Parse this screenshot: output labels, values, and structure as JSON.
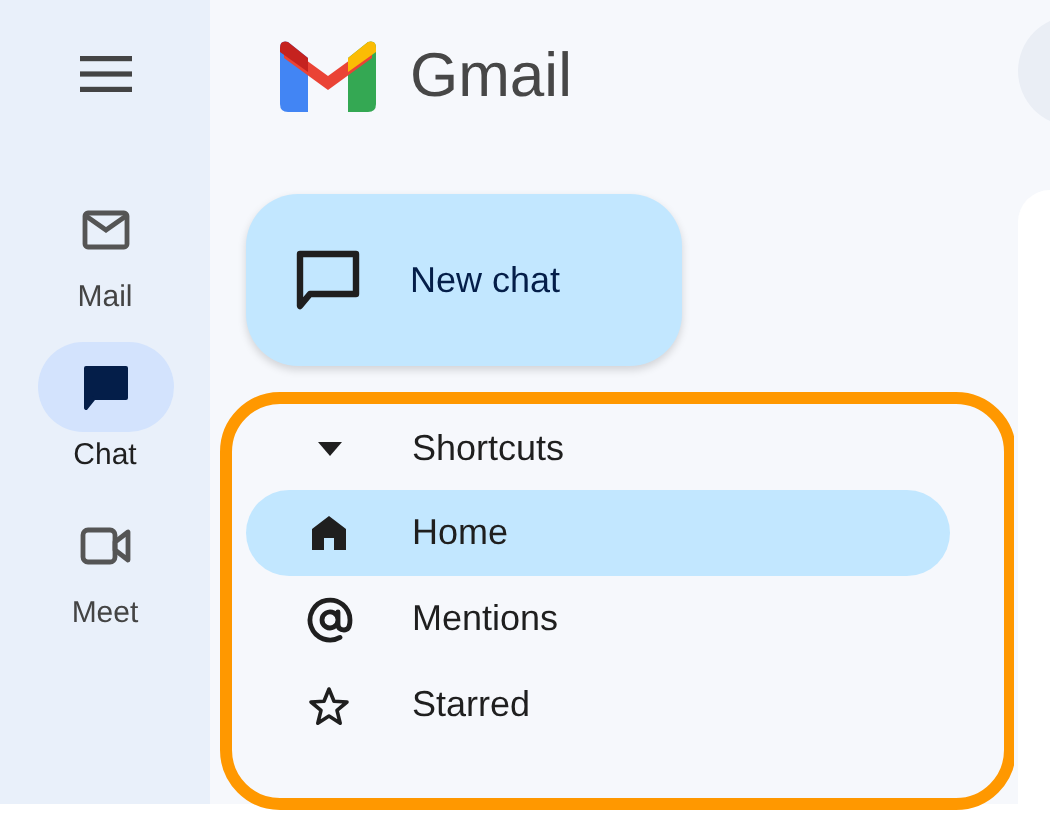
{
  "rail": {
    "items": [
      {
        "kind": "mail",
        "label": "Mail",
        "selected": false
      },
      {
        "kind": "chat",
        "label": "Chat",
        "selected": true
      },
      {
        "kind": "meet",
        "label": "Meet",
        "selected": false
      }
    ]
  },
  "brand": {
    "name": "Gmail"
  },
  "compose": {
    "label": "New chat"
  },
  "shortcuts": {
    "title": "Shortcuts",
    "expanded": true,
    "items": [
      {
        "kind": "home",
        "label": "Home",
        "selected": true
      },
      {
        "kind": "mentions",
        "label": "Mentions",
        "selected": false
      },
      {
        "kind": "starred",
        "label": "Starred",
        "selected": false
      }
    ]
  }
}
